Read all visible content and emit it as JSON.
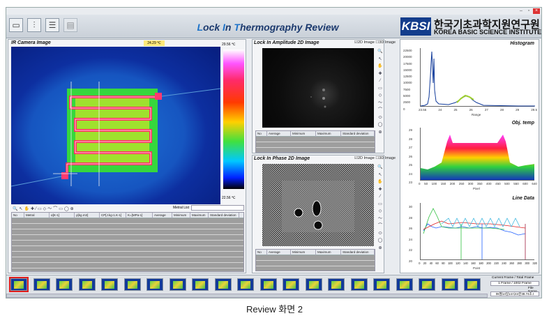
{
  "app": {
    "title_parts": [
      "L",
      "ock ",
      "I",
      "n ",
      "T",
      "hermography Review"
    ],
    "logo_mark": "KBSI",
    "org_korean": "한국기초과학지원연구원",
    "org_english": "KOREA BASIC SCIENCE INSTITUTE"
  },
  "window_buttons": [
    "–",
    "▫",
    "×"
  ],
  "toolbar": {
    "icons": [
      "window-icon",
      "sliders-icon",
      "list-icon",
      "document-icon"
    ]
  },
  "ir_panel": {
    "title": "IR Camera Image",
    "temp_badge": "24.29 ℃",
    "scale_max": "29.56 ℃",
    "scale_min": "22.56 ℃",
    "metal_list_label": "Metral List",
    "table_headers": [
      "No",
      "Metral",
      "α[K-1]",
      "ρ[kg.m3]",
      "CP[J.kg-1.K-1]",
      "K=[MPa-1]",
      "Average",
      "Minimum",
      "Maximum",
      "Standard deviation"
    ]
  },
  "amp_panel": {
    "title": "Lock In Amplitude 2D Image",
    "opt_2d": "2D Image",
    "opt_3d": "3D Image",
    "table_headers": [
      "No",
      "Average",
      "Minimum",
      "Maximum",
      "Standard deviation"
    ]
  },
  "phase_panel": {
    "title": "Lock In Phase 2D Image",
    "opt_2d": "2D Image",
    "opt_3d": "3D Image",
    "table_headers": [
      "No",
      "Average",
      "Minimum",
      "Maximum",
      "Standard deviation"
    ]
  },
  "histogram": {
    "title": "Histogram",
    "xlabel": "Range",
    "yticks": [
      "22500",
      "20000",
      "17500",
      "15000",
      "12500",
      "10000",
      "7500",
      "5000",
      "2500",
      "0"
    ],
    "xticks": [
      "23.56",
      "24",
      "25",
      "26",
      "27",
      "28",
      "29",
      "29.5"
    ]
  },
  "objtemp": {
    "title": "Obj. temp",
    "xlabel": "Pixel",
    "yticks": [
      "29",
      "28",
      "27",
      "26",
      "25",
      "24",
      "23"
    ],
    "xticks": [
      "0",
      "50",
      "100",
      "150",
      "200",
      "250",
      "300",
      "350",
      "400",
      "450",
      "500",
      "550",
      "600",
      "640"
    ]
  },
  "linedata": {
    "title": "Line Data",
    "xlabel": "Point",
    "yticks": [
      "30",
      "28",
      "26",
      "24",
      "22",
      "20"
    ],
    "xticks": [
      "0",
      "20",
      "40",
      "60",
      "80",
      "100",
      "120",
      "140",
      "160",
      "180",
      "200",
      "220",
      "240",
      "260",
      "280",
      "300",
      "320"
    ]
  },
  "frames": {
    "current_label": "Current Frame / Total Frame",
    "current_value": "1 Frame / 1002 Frame",
    "file_label": "File Name",
    "file_value": "06월14일14시44분38.74초.t"
  },
  "caption": "Review 화면 2",
  "colors": {
    "accent": "#1d73c9",
    "title_dark": "#1c3a6e",
    "logo": "#133d8c",
    "selected_thumb": "#e02020"
  }
}
